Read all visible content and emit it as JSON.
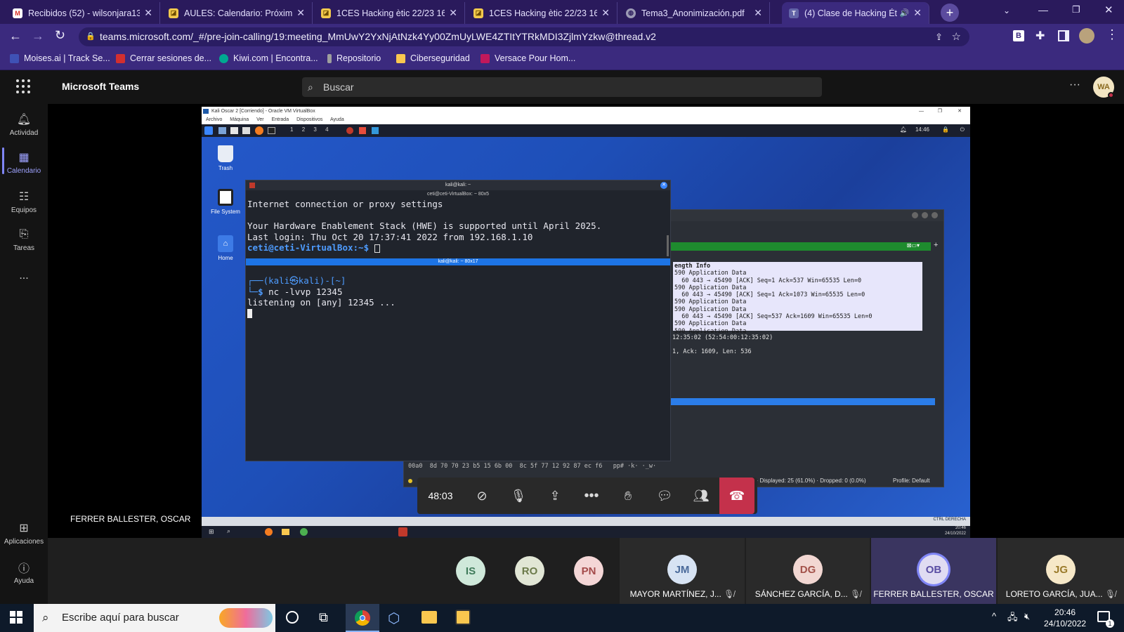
{
  "browser": {
    "tabs": [
      {
        "title": "Recibidos (52) - wilsonjara13",
        "icon": "gmail-icon",
        "active": false
      },
      {
        "title": "AULES: Calendario: Próximos",
        "icon": "aules-icon",
        "active": false
      },
      {
        "title": "1CES Hacking ètic 22/23 166",
        "icon": "aules-icon",
        "active": false
      },
      {
        "title": "1CES Hacking ètic 22/23 166",
        "icon": "aules-icon",
        "active": false
      },
      {
        "title": "Tema3_Anonimización.pdf",
        "icon": "globe-icon",
        "active": false
      },
      {
        "title": "(4) Clase de Hacking Étic",
        "icon": "teams-icon",
        "active": true
      }
    ],
    "url": "teams.microsoft.com/_#/pre-join-calling/19:meeting_MmUwY2YxNjAtNzk4Yy00ZmUyLWE4ZTItYTRkMDI3ZjlmYzkw@thread.v2",
    "bookmarks": [
      {
        "label": "Moises.ai | Track Se...",
        "color": "#3f51b5"
      },
      {
        "label": "Cerrar sesiones de...",
        "color": "#d32f2f"
      },
      {
        "label": "Kiwi.com | Encontra...",
        "color": "#00a991"
      },
      {
        "label": "Repositorio",
        "color": "#9e9e9e"
      },
      {
        "label": "Ciberseguridad",
        "color": "#f9c74f"
      },
      {
        "label": "Versace Pour Hom...",
        "color": "#c2185b"
      }
    ],
    "profile_initial": "B"
  },
  "teams": {
    "app_name": "Microsoft Teams",
    "search_placeholder": "Buscar",
    "user_initials": "WA",
    "rail": [
      {
        "label": "Actividad",
        "icon": "bell-icon",
        "active": false
      },
      {
        "label": "Calendario",
        "icon": "calendar-icon",
        "active": true
      },
      {
        "label": "Equipos",
        "icon": "teams-icon",
        "active": false
      },
      {
        "label": "Tareas",
        "icon": "tasks-icon",
        "active": false
      },
      {
        "label": "...",
        "icon": "more-icon",
        "active": false
      }
    ],
    "rail_bottom": [
      {
        "label": "Aplicaciones",
        "icon": "apps-icon"
      },
      {
        "label": "Ayuda",
        "icon": "help-icon"
      }
    ],
    "presenter_name": "FERRER BALLESTER, OSCAR",
    "call_timer": "48:03",
    "participants_small": [
      {
        "initials": "IS",
        "bg": "#cfe8da",
        "fg": "#3f7a5a"
      },
      {
        "initials": "RO",
        "bg": "#e1e6d5",
        "fg": "#6b7a4a"
      },
      {
        "initials": "PN",
        "bg": "#f4d6d6",
        "fg": "#a34a4a"
      }
    ],
    "participants": [
      {
        "initials": "JM",
        "name": "MAYOR MARTÍNEZ, J...",
        "bg": "#d7e3f3",
        "fg": "#4a6a9a",
        "muted": true,
        "active": false
      },
      {
        "initials": "DG",
        "name": "SÁNCHEZ GARCÍA, D...",
        "bg": "#f2d7d2",
        "fg": "#a3524a",
        "muted": true,
        "active": false
      },
      {
        "initials": "OB",
        "name": "FERRER BALLESTER, OSCAR",
        "bg": "#e0dcf2",
        "fg": "#5a4ea3",
        "muted": false,
        "active": true
      },
      {
        "initials": "JG",
        "name": "LORETO GARCÍA, JUA...",
        "bg": "#f6e8c8",
        "fg": "#9a7a2a",
        "muted": true,
        "active": false
      }
    ]
  },
  "vm": {
    "title": "Kali Oscar 2 [Corriendo] - Oracle VM VirtualBox",
    "menu": [
      "Archivo",
      "Máquina",
      "Ver",
      "Entrada",
      "Dispositivos",
      "Ayuda"
    ],
    "workspaces": [
      "1",
      "2",
      "3",
      "4"
    ],
    "clock": "14:46",
    "desktop_icons": [
      "Trash",
      "File System",
      "Home"
    ],
    "terminal": {
      "title": "kali@kali: ~",
      "subtitle": "ceti@ceti-VirtualBox: ~ 80x5",
      "top_lines": [
        "Internet connection or proxy settings",
        "",
        "Your Hardware Enablement Stack (HWE) is supported until April 2025.",
        "Last login: Thu Oct 20 17:37:41 2022 from 192.168.1.10"
      ],
      "remote_prompt": "ceti@ceti-VirtualBox:~$",
      "pane_title": "kali@kali: ~ 80x17",
      "prompt_user": "(kali㉿kali)-[~]",
      "command": "nc -lvvp 12345",
      "output": "listening on [any] 12345 ..."
    },
    "wireshark": {
      "header": "ength Info",
      "rows": [
        "590 Application Data",
        "  60 443 → 45490 [ACK] Seq=1 Ack=537 Win=65535 Len=0",
        "590 Application Data",
        "  60 443 → 45490 [ACK] Seq=1 Ack=1073 Win=65535 Len=0",
        "590 Application Data",
        "590 Application Data",
        "  60 443 → 45490 [ACK] Seq=537 Ack=1609 Win=65535 Len=0",
        "590 Application Data",
        "590 Application Data"
      ],
      "detail1": "12:35:02 (52:54:00:12:35:02)",
      "detail2": "1, Ack: 1609, Len: 536",
      "hex_line": "00a0  8d 70 70 23 b5 15 6b 00  8c 5f 77 12 92 87 ec f6   pp# ·k· ·_w·",
      "status": "s: 41 · Displayed: 25 (61.0%) · Dropped: 0 (0.0%)",
      "profile": "Profile: Default"
    },
    "win_clock": "20:46",
    "win_date": "24/10/2022",
    "host_key": "CTRL DERECHA"
  },
  "windows": {
    "search_placeholder": "Escribe aquí para buscar",
    "time": "20:46",
    "date": "24/10/2022",
    "notification_count": "1"
  }
}
